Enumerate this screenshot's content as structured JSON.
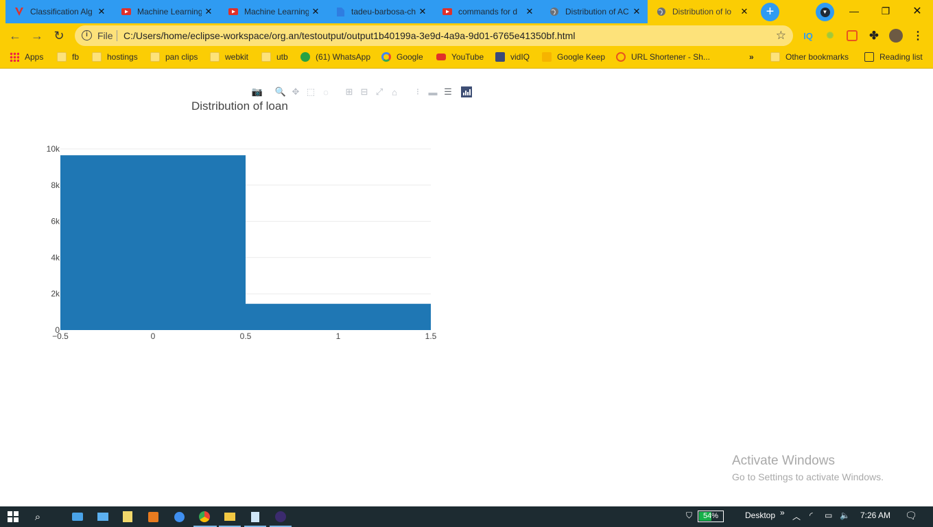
{
  "tabs": [
    {
      "title": "Classification Alg",
      "icon": "vivaldi-icon",
      "color": "#e0302a"
    },
    {
      "title": "Machine Learning",
      "icon": "youtube-icon",
      "color": "#e0302a"
    },
    {
      "title": "Machine Learning",
      "icon": "youtube-icon",
      "color": "#e0302a"
    },
    {
      "title": "tadeu-barbosa-ch",
      "icon": "page-icon",
      "color": "#2f7de1"
    },
    {
      "title": "commands for d",
      "icon": "youtube-icon",
      "color": "#e0302a"
    },
    {
      "title": "Distribution of AC",
      "icon": "globe-icon",
      "color": "#5f6368"
    },
    {
      "title": "Distribution of lo",
      "icon": "globe-icon",
      "color": "#5f6368"
    }
  ],
  "active_tab_index": 6,
  "toolbar": {
    "file_label": "File",
    "url": "C:/Users/home/eclipse-workspace/org.an/testoutput/output1b40199a-3e9d-4a9a-9d01-6765e41350bf.html",
    "ext_iq": "IQ"
  },
  "bookmarks": {
    "apps": "Apps",
    "items": [
      "fb",
      "hostings",
      "pan clips",
      "webkit",
      "utb",
      "(61) WhatsApp",
      "Google",
      "YouTube",
      "vidIQ",
      "Google Keep",
      "URL Shortener - Sh..."
    ],
    "more": "»",
    "other": "Other bookmarks",
    "reading_list": "Reading list"
  },
  "chart_data": {
    "type": "bar",
    "title": "Distribution of  loan",
    "categories": [
      "0",
      "1"
    ],
    "bins": [
      [
        -0.5,
        0.5
      ],
      [
        0.5,
        1.5
      ]
    ],
    "values": [
      9650,
      1450
    ],
    "xlim": [
      -0.5,
      1.5
    ],
    "ylim": [
      0,
      10000
    ],
    "x_ticks": [
      "−0.5",
      "0",
      "0.5",
      "1",
      "1.5"
    ],
    "x_tick_values": [
      -0.5,
      0,
      0.5,
      1,
      1.5
    ],
    "y_ticks": [
      "0",
      "2k",
      "4k",
      "6k",
      "8k",
      "10k"
    ],
    "y_tick_values": [
      0,
      2000,
      4000,
      6000,
      8000,
      10000
    ],
    "bar_color": "#1f77b4",
    "grid": true
  },
  "watermark": {
    "line1": "Activate Windows",
    "line2": "Go to Settings to activate Windows."
  },
  "taskbar": {
    "battery": "54%",
    "desktop_label": "Desktop",
    "chevron": "»",
    "time": "7:26 AM"
  }
}
